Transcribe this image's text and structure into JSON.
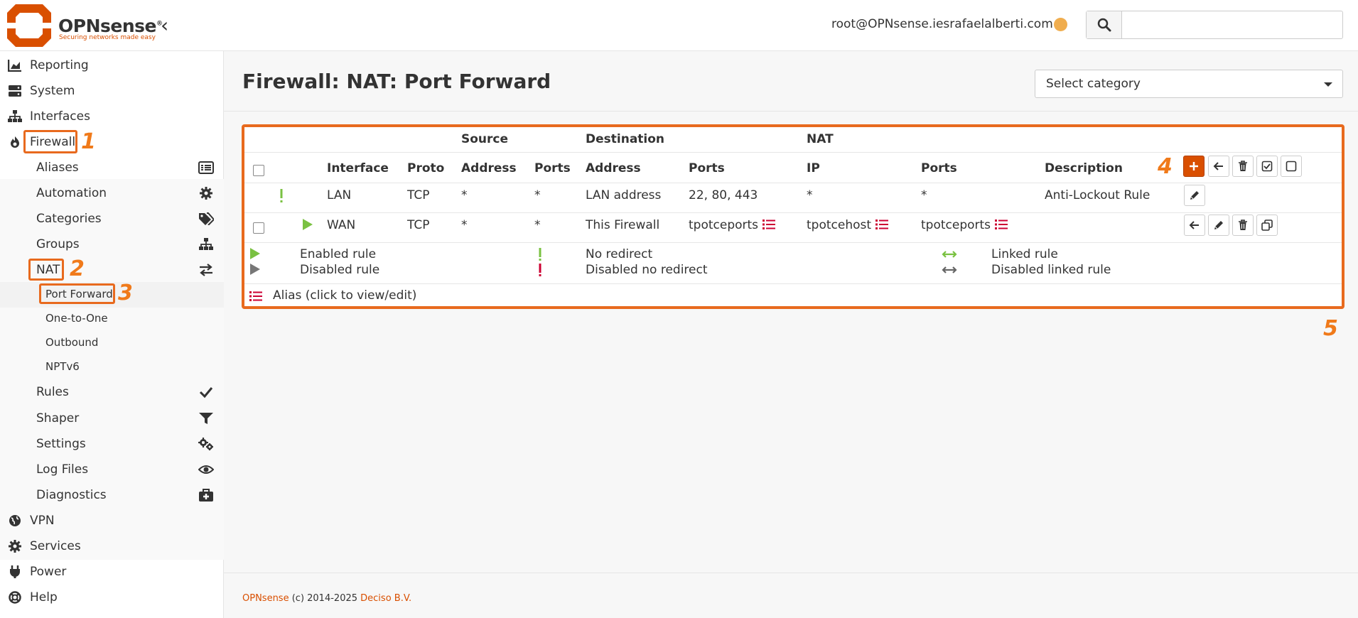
{
  "header": {
    "brand": "OPNsense",
    "brand_mark": "®",
    "tagline": "Securing networks made easy",
    "user": "root@OPNsense.iesrafaelalberti.com",
    "search_placeholder": ""
  },
  "sidebar": {
    "items": [
      {
        "label": "Reporting",
        "icon": "chart-area-icon"
      },
      {
        "label": "System",
        "icon": "server-icon"
      },
      {
        "label": "Interfaces",
        "icon": "sitemap-icon"
      },
      {
        "label": "Firewall",
        "icon": "fire-icon"
      },
      {
        "label": "VPN",
        "icon": "globe-icon"
      },
      {
        "label": "Services",
        "icon": "cog-icon"
      },
      {
        "label": "Power",
        "icon": "plug-icon"
      },
      {
        "label": "Help",
        "icon": "life-ring-icon"
      }
    ],
    "firewall_sub": [
      {
        "label": "Aliases",
        "icon": "list-alt-icon"
      },
      {
        "label": "Automation",
        "icon": "gear-icon"
      },
      {
        "label": "Categories",
        "icon": "tags-icon"
      },
      {
        "label": "Groups",
        "icon": "sitemap-icon"
      },
      {
        "label": "NAT",
        "icon": "exchange-icon"
      },
      {
        "label": "Rules",
        "icon": "check-icon"
      },
      {
        "label": "Shaper",
        "icon": "filter-icon"
      },
      {
        "label": "Settings",
        "icon": "cogs-icon"
      },
      {
        "label": "Log Files",
        "icon": "eye-icon"
      },
      {
        "label": "Diagnostics",
        "icon": "medkit-icon"
      }
    ],
    "nat_sub": [
      "Port Forward",
      "One-to-One",
      "Outbound",
      "NPTv6"
    ]
  },
  "annotations": [
    "1",
    "2",
    "3",
    "4",
    "5"
  ],
  "page": {
    "title": "Firewall: NAT: Port Forward",
    "category_placeholder": "Select category"
  },
  "table": {
    "groups": {
      "source": "Source",
      "destination": "Destination",
      "nat": "NAT"
    },
    "columns": {
      "interface": "Interface",
      "proto": "Proto",
      "src_address": "Address",
      "src_ports": "Ports",
      "dst_address": "Address",
      "dst_ports": "Ports",
      "nat_ip": "IP",
      "nat_ports": "Ports",
      "description": "Description"
    },
    "rows": [
      {
        "interface": "LAN",
        "proto": "TCP",
        "src_address": "*",
        "src_ports": "*",
        "dst_address": "LAN address",
        "dst_ports": "22, 80, 443",
        "nat_ip": "*",
        "nat_ports": "*",
        "description": "Anti-Lockout Rule"
      },
      {
        "interface": "WAN",
        "proto": "TCP",
        "src_address": "*",
        "src_ports": "*",
        "dst_address": "This Firewall",
        "dst_ports": "tpotceports",
        "nat_ip": "tpotcehost",
        "nat_ports": "tpotceports",
        "description": ""
      }
    ],
    "legend": {
      "enabled_rule": "Enabled rule",
      "disabled_rule": "Disabled rule",
      "no_redirect": "No redirect",
      "disabled_no_redirect": "Disabled no redirect",
      "linked_rule": "Linked rule",
      "disabled_linked_rule": "Disabled linked rule",
      "alias": "Alias (click to view/edit)"
    }
  },
  "footer": {
    "brand": "OPNsense",
    "copyright": "(c) 2014-2025",
    "company": "Deciso B.V."
  },
  "colors": {
    "accent": "#d94f00",
    "highlight": "#e86a1e",
    "green": "#7ac142",
    "status_dot": "#f0ad4e"
  }
}
